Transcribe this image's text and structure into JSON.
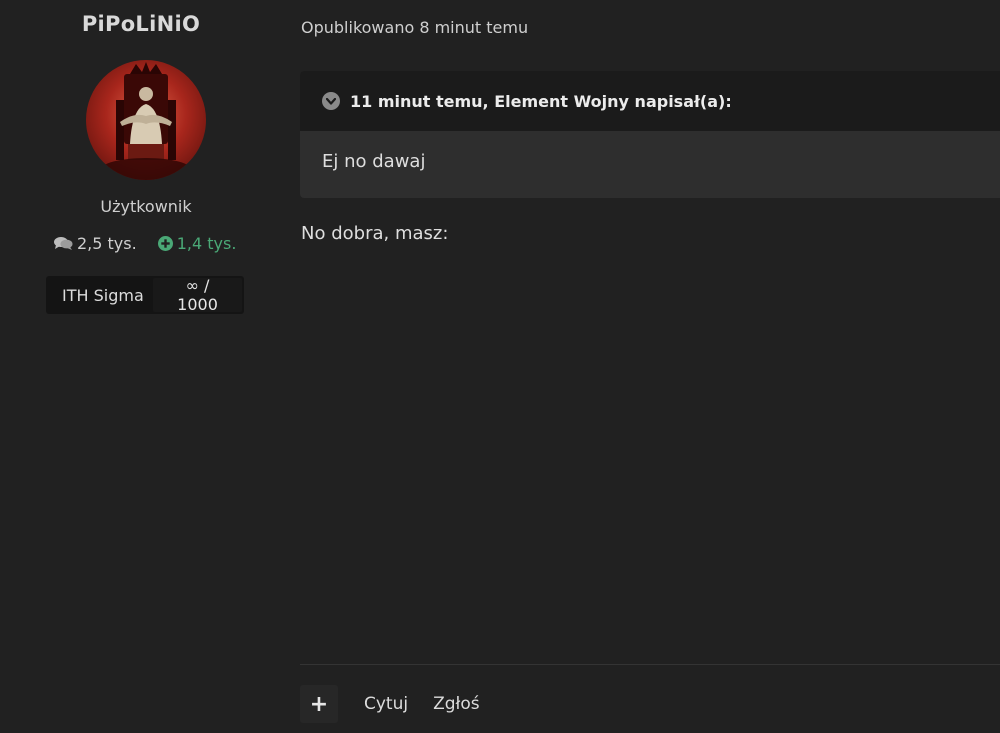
{
  "author": {
    "username": "PiPoLiNiO",
    "rank": "Użytkownik",
    "posts_count": "2,5 tys.",
    "reputation": "1,4 tys.",
    "badge": {
      "name": "ITH Sigma",
      "value": "∞ / 1000"
    }
  },
  "post": {
    "published": "Opublikowano 8 minut temu",
    "quote": {
      "header": "11 minut temu, Element Wojny napisał(a):",
      "body": "Ej no dawaj"
    },
    "content": "No dobra, masz:"
  },
  "actions": {
    "plus_label": "+",
    "quote_label": "Cytuj",
    "report_label": "Zgłoś"
  },
  "colors": {
    "background": "#212121",
    "quote_header": "#1b1b1b",
    "quote_body": "#2e2e2e",
    "reputation": "#4aa876"
  },
  "icons": {
    "posts": "comments-icon",
    "reputation": "plus-circle-icon",
    "quote_toggle": "chevron-down-circle-icon"
  }
}
